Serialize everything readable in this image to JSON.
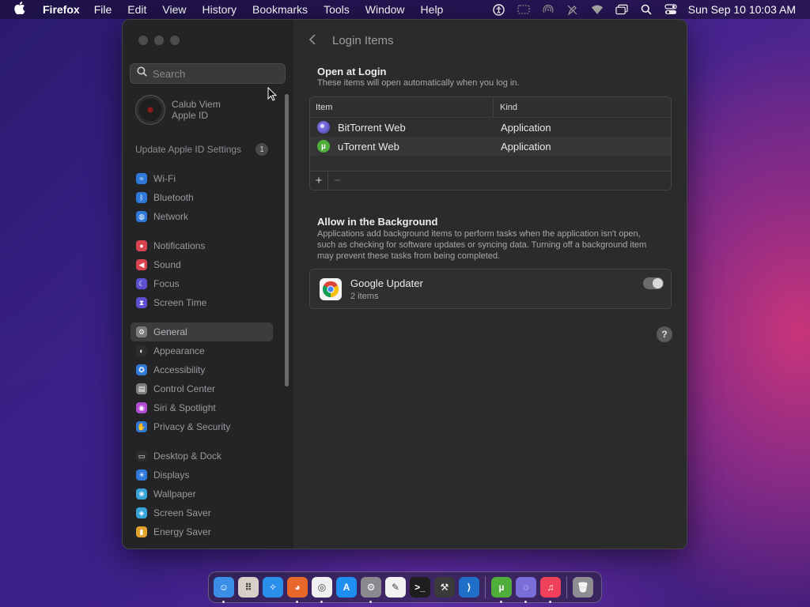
{
  "menubar": {
    "app_name": "Firefox",
    "menus": [
      "File",
      "Edit",
      "View",
      "History",
      "Bookmarks",
      "Tools",
      "Window",
      "Help"
    ],
    "clock": "Sun Sep 10  10:03 AM",
    "status_icons": [
      "accessibility-icon",
      "screen-record-icon",
      "airdrop-icon",
      "pen-icon",
      "wifi-icon",
      "window-icon",
      "spotlight-icon",
      "control-center-icon"
    ]
  },
  "sidebar": {
    "search_placeholder": "Search",
    "account_name": "Calub Viem",
    "account_sub": "Apple ID",
    "update_label": "Update Apple ID Settings",
    "update_badge": "1",
    "groups": [
      [
        {
          "label": "Wi-Fi",
          "icon": "wifi-icon",
          "color": "#2f7ad9"
        },
        {
          "label": "Bluetooth",
          "icon": "bluetooth-icon",
          "color": "#2f7ad9"
        },
        {
          "label": "Network",
          "icon": "globe-icon",
          "color": "#2f7ad9"
        }
      ],
      [
        {
          "label": "Notifications",
          "icon": "bell-icon",
          "color": "#d9434d"
        },
        {
          "label": "Sound",
          "icon": "speaker-icon",
          "color": "#d9434d"
        },
        {
          "label": "Focus",
          "icon": "moon-icon",
          "color": "#5b4fd0"
        },
        {
          "label": "Screen Time",
          "icon": "hourglass-icon",
          "color": "#5b4fd0"
        }
      ],
      [
        {
          "label": "General",
          "icon": "gear-icon",
          "color": "#7d7d80",
          "active": true
        },
        {
          "label": "Appearance",
          "icon": "appearance-icon",
          "color": "#2d2d2f"
        },
        {
          "label": "Accessibility",
          "icon": "accessibility-icon",
          "color": "#2f7ad9"
        },
        {
          "label": "Control Center",
          "icon": "control-center-icon",
          "color": "#7d7d80"
        },
        {
          "label": "Siri & Spotlight",
          "icon": "siri-icon",
          "color": "#b14bd1"
        },
        {
          "label": "Privacy & Security",
          "icon": "hand-icon",
          "color": "#2f7ad9"
        }
      ],
      [
        {
          "label": "Desktop & Dock",
          "icon": "dock-icon",
          "color": "#2d2d2f"
        },
        {
          "label": "Displays",
          "icon": "display-icon",
          "color": "#2f7ad9"
        },
        {
          "label": "Wallpaper",
          "icon": "wallpaper-icon",
          "color": "#36a3d9"
        },
        {
          "label": "Screen Saver",
          "icon": "screen-saver-icon",
          "color": "#36a3d9"
        },
        {
          "label": "Energy Saver",
          "icon": "battery-icon",
          "color": "#e3a22b"
        }
      ]
    ]
  },
  "content": {
    "title": "Login Items",
    "open_at_login": {
      "heading": "Open at Login",
      "subtitle": "These items will open automatically when you log in.",
      "columns": [
        "Item",
        "Kind"
      ],
      "rows": [
        {
          "name": "BitTorrent Web",
          "kind": "Application",
          "icon": "bittorrent-icon",
          "color": "#6f6fd8"
        },
        {
          "name": "uTorrent Web",
          "kind": "Application",
          "icon": "utorrent-icon",
          "color": "#4fae3a"
        }
      ],
      "add_label": "+",
      "remove_label": "−"
    },
    "background": {
      "heading": "Allow in the Background",
      "subtitle": "Applications add background items to perform tasks when the application isn't open, such as checking for software updates or syncing data. Turning off a background item may prevent these tasks from being completed.",
      "items": [
        {
          "name": "Google Updater",
          "count": "2 items",
          "icon": "chrome-icon",
          "enabled": true
        }
      ]
    },
    "help_label": "?"
  },
  "dock": {
    "apps": [
      {
        "name": "finder-icon",
        "color": "#3a8ee6",
        "running": true
      },
      {
        "name": "launchpad-icon",
        "color": "#d8d0c8",
        "running": false
      },
      {
        "name": "safari-icon",
        "color": "#2a8fe8",
        "running": false
      },
      {
        "name": "firefox-icon",
        "color": "#e8672a",
        "running": true
      },
      {
        "name": "chrome-icon",
        "color": "#f0f0f0",
        "running": true
      },
      {
        "name": "app-store-icon",
        "color": "#1f8ef1",
        "running": false
      },
      {
        "name": "system-settings-icon",
        "color": "#8a8a8e",
        "running": true
      },
      {
        "name": "textedit-icon",
        "color": "#f2f2f2",
        "running": false
      },
      {
        "name": "terminal-icon",
        "color": "#1e1e1e",
        "running": false
      },
      {
        "name": "utilities-icon",
        "color": "#3a3a3a",
        "running": false
      },
      {
        "name": "vscode-icon",
        "color": "#1f6fc9",
        "running": false
      },
      {
        "name": "utorrent-icon",
        "color": "#4fae3a",
        "running": true
      },
      {
        "name": "bittorrent-icon",
        "color": "#7a6fd8",
        "running": true
      },
      {
        "name": "music-icon",
        "color": "#f0405a",
        "running": true
      },
      {
        "name": "trash-icon",
        "color": "#8e8e92",
        "running": false
      }
    ]
  }
}
